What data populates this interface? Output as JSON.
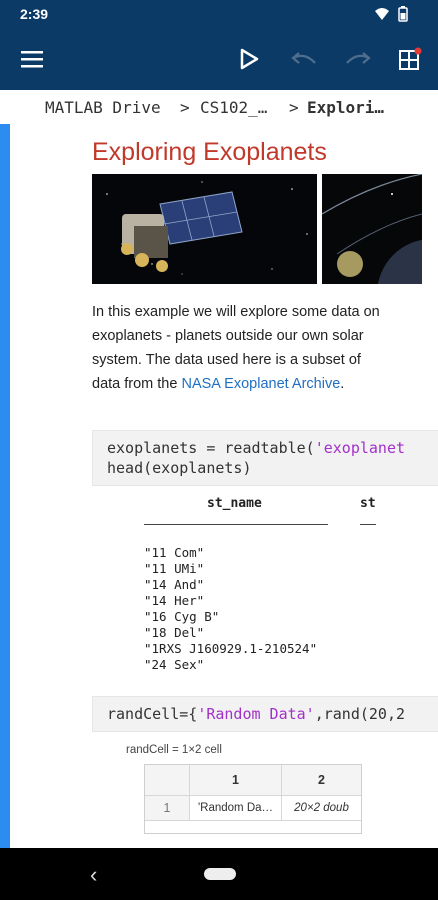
{
  "status_bar": {
    "time": "2:39"
  },
  "app_bar": {
    "menu_icon": "hamburger-icon",
    "run_icon": "play-icon",
    "undo_icon": "undo-icon",
    "redo_icon": "redo-icon",
    "layout_icon": "grid-icon"
  },
  "breadcrumb": {
    "root": "MATLAB Drive",
    "sep1": ">",
    "folder": "CS102_…",
    "sep2": ">",
    "current": "Explori…"
  },
  "live_script": {
    "title": "Exploring Exoplanets",
    "images": [
      "Kepler spacecraft in space",
      "Exoplanet passing in front of a star"
    ],
    "paragraph_text": "In this example we will explore some data on exoplanets - planets outside our own solar system.  The data used here is a subset of data from the ",
    "link_text": "NASA Exoplanet Archive",
    "paragraph_end": ".",
    "code1": {
      "line1_prefix": "exoplanets = readtable(",
      "line1_string": "'exoplanet",
      "line2": "head(exoplanets)"
    },
    "table": {
      "col1": "st_name",
      "col2": "st",
      "rows": [
        "\"11 Com\"",
        "\"11 UMi\"",
        "\"14 And\"",
        "\"14 Her\"",
        "\"16 Cyg B\"",
        "\"18 Del\"",
        "\"1RXS J160929.1-210524\"",
        "\"24 Sex\""
      ]
    },
    "code2": {
      "prefix": "randCell={",
      "string": "'Random Data'",
      "suffix": ",rand(20,2"
    },
    "cell_output": {
      "caption": "randCell = 1×2 cell",
      "header": [
        "",
        "1",
        "2"
      ],
      "row": [
        "1",
        "'Random Da…",
        "20×2 doub"
      ]
    }
  },
  "colors": {
    "app_bar": "#0b3a67",
    "accent": "#2d8cf0",
    "title": "#c0392b",
    "link": "#1f6fc2",
    "string": "#a230c9"
  }
}
